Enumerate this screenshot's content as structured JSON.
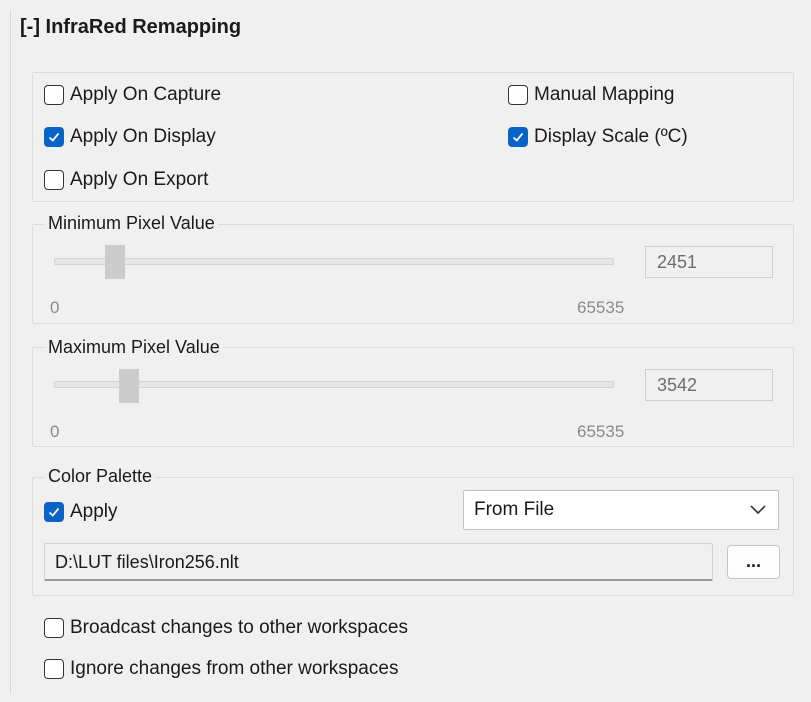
{
  "section": {
    "header": "[-] InfraRed Remapping"
  },
  "options": {
    "apply_on_capture": {
      "label": "Apply On Capture",
      "checked": false
    },
    "apply_on_display": {
      "label": "Apply On Display",
      "checked": true
    },
    "apply_on_export": {
      "label": "Apply On Export",
      "checked": false
    },
    "manual_mapping": {
      "label": "Manual Mapping",
      "checked": false
    },
    "display_scale": {
      "label": "Display Scale (ºC)",
      "checked": true
    }
  },
  "min_pixel": {
    "legend": "Minimum Pixel Value",
    "value": "2451",
    "min_label": "0",
    "max_label": "65535",
    "slider_value": 2451,
    "slider_max": 65535
  },
  "max_pixel": {
    "legend": "Maximum Pixel Value",
    "value": "3542",
    "min_label": "0",
    "max_label": "65535",
    "slider_value": 3542,
    "slider_max": 65535
  },
  "palette": {
    "legend": "Color Palette",
    "apply": {
      "label": "Apply",
      "checked": true
    },
    "source_selected": "From File",
    "file_path": "D:\\LUT files\\Iron256.nlt",
    "browse_label": "..."
  },
  "workspace": {
    "broadcast": {
      "label": "Broadcast changes to other workspaces",
      "checked": false
    },
    "ignore": {
      "label": "Ignore changes from other workspaces",
      "checked": false
    }
  },
  "colors": {
    "accent": "#0a64c8",
    "background": "#f0f0f0"
  },
  "icons": {
    "checkmark": "checkmark-icon",
    "dropdown": "chevron-down-icon"
  }
}
